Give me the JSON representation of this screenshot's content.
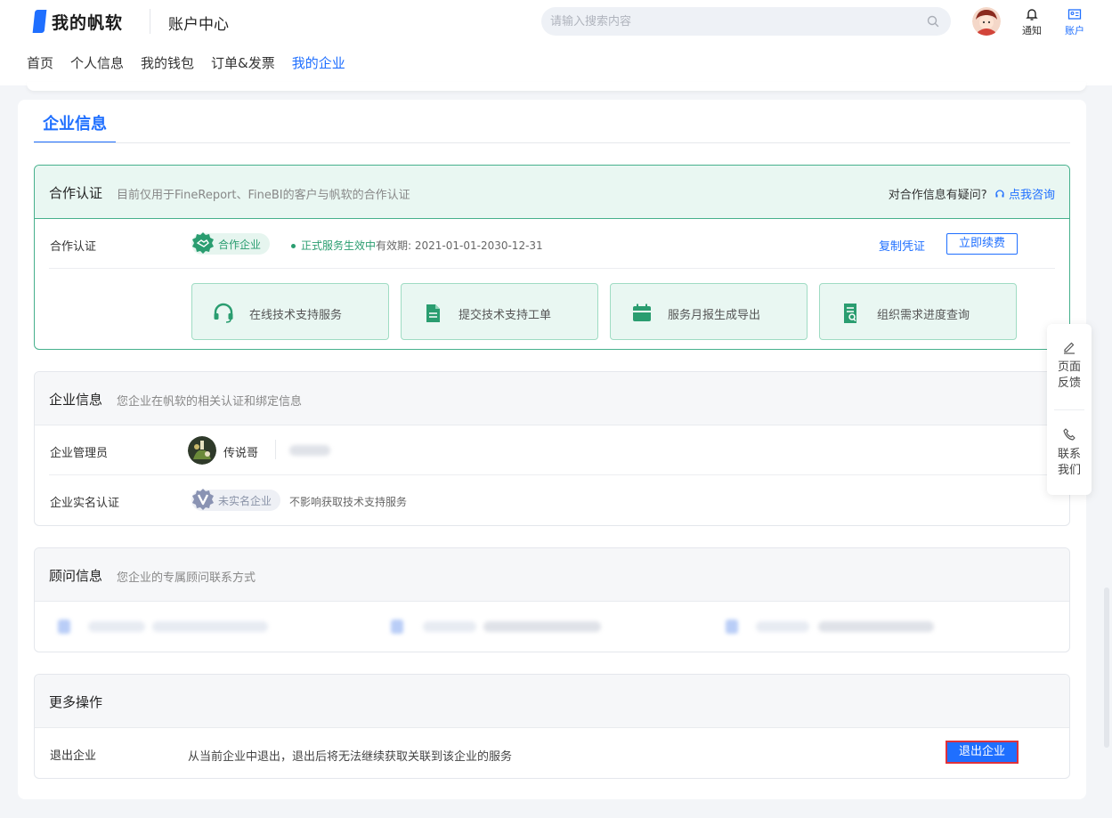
{
  "header": {
    "logo_text": "我的帆软",
    "title": "账户中心",
    "search_placeholder": "请输入搜索内容",
    "notify_label": "通知",
    "account_label": "账户"
  },
  "nav": {
    "items": [
      "首页",
      "个人信息",
      "我的钱包",
      "订单&发票",
      "我的企业"
    ],
    "active": "我的企业"
  },
  "main": {
    "tab": "企业信息"
  },
  "coop": {
    "title": "合作认证",
    "desc": "目前仅用于FineReport、FineBI的客户与帆软的合作认证",
    "ask_text": "对合作信息有疑问?",
    "ask_link": "点我咨询",
    "row_label": "合作认证",
    "badge": "合作企业",
    "status_ok": "正式服务生效中",
    "status_valid": "有效期: 2021-01-01-2030-12-31",
    "copy_link": "复制凭证",
    "renew_button": "立即续费",
    "services": [
      "在线技术支持服务",
      "提交技术支持工单",
      "服务月报生成导出",
      "组织需求进度查询"
    ]
  },
  "company": {
    "title": "企业信息",
    "desc": "您企业在帆软的相关认证和绑定信息",
    "admin_label": "企业管理员",
    "admin_name": "传说哥",
    "realname_label": "企业实名认证",
    "realname_badge": "未实名企业",
    "realname_note": "不影响获取技术支持服务"
  },
  "advisor": {
    "title": "顾问信息",
    "desc": "您企业的专属顾问联系方式"
  },
  "more": {
    "title": "更多操作",
    "exit_label": "退出企业",
    "exit_desc": "从当前企业中退出，退出后将无法继续获取关联到该企业的服务",
    "exit_button": "退出企业"
  },
  "float": {
    "feedback": [
      "页面",
      "反馈"
    ],
    "contact": [
      "联系",
      "我们"
    ]
  },
  "colors": {
    "accent": "#1f6fff",
    "green": "#2a9d70",
    "danger_border": "#e0313a"
  }
}
